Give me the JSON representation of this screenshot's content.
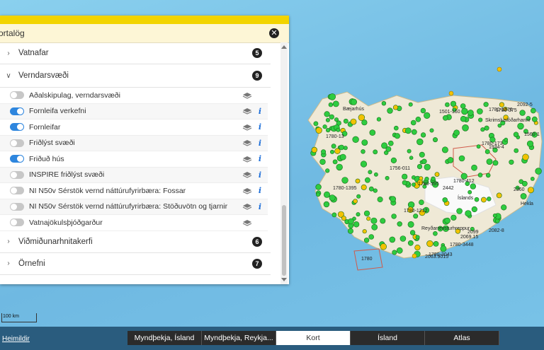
{
  "panel": {
    "title": "ortalög",
    "close_icon": "close-icon"
  },
  "groups": [
    {
      "label": "Vatnafar",
      "count": "5",
      "expanded": false
    },
    {
      "label": "Verndarsvæði",
      "count": "9",
      "expanded": true
    },
    {
      "label": "Viðmiðunarhnitakerfi",
      "count": "6",
      "expanded": false
    },
    {
      "label": "Örnefni",
      "count": "7",
      "expanded": false
    }
  ],
  "layers": [
    {
      "label": "Aðalskipulag, verndarsvæði",
      "on": false,
      "info": false
    },
    {
      "label": "Fornleifa verkefni",
      "on": true,
      "info": true
    },
    {
      "label": "Fornleifar",
      "on": true,
      "info": true
    },
    {
      "label": "Friðlýst svæði",
      "on": false,
      "info": true
    },
    {
      "label": "Friðuð hús",
      "on": true,
      "info": true
    },
    {
      "label": "INSPIRE friðlýst svæði",
      "on": false,
      "info": true
    },
    {
      "label": "NI N50v Sérstök vernd náttúrufyrirbæra: Fossar",
      "on": false,
      "info": true
    },
    {
      "label": "NI N50v Sérstök vernd náttúrufyrirbæra: Stöðuvötn og tjarnir",
      "on": false,
      "info": true
    },
    {
      "label": "Vatnajökulsþjóðgarður",
      "on": false,
      "info": false
    }
  ],
  "info_glyph": "i",
  "scale": {
    "label": "100 km"
  },
  "footer": {
    "source_link": "Heimildir"
  },
  "basemaps": [
    {
      "label": "Myndþekja, Ísland",
      "active": false
    },
    {
      "label": "Myndþekja, Reykja...",
      "active": false
    },
    {
      "label": "Kort",
      "active": true
    },
    {
      "label": "Ísland",
      "active": false
    },
    {
      "label": "Atlas",
      "active": false
    }
  ],
  "map": {
    "labels": [
      "Bæjarhús",
      "1780-375",
      "2092-5",
      "1501-160",
      "1780-1376",
      "Skrimsluslóðarhanni",
      "1560-1",
      "1780-173",
      "1934-4",
      "1756-011",
      "1780-412",
      "1780-395",
      "2442",
      "Íslands",
      "1780-3448",
      "1780-3043",
      "1780-1212",
      "1780-1395",
      "1780",
      "Reyðarrevsturhreppur",
      "2360",
      "Hekla",
      "2099",
      "2069.15",
      "2063.9015",
      "2082-8",
      "1780-13"
    ],
    "colors": {
      "sea": "#7fc6e6",
      "land": "#f1ead8",
      "point_green": "#2ecc40",
      "point_yellow": "#f2c200",
      "boundary": "#c0392b"
    }
  }
}
